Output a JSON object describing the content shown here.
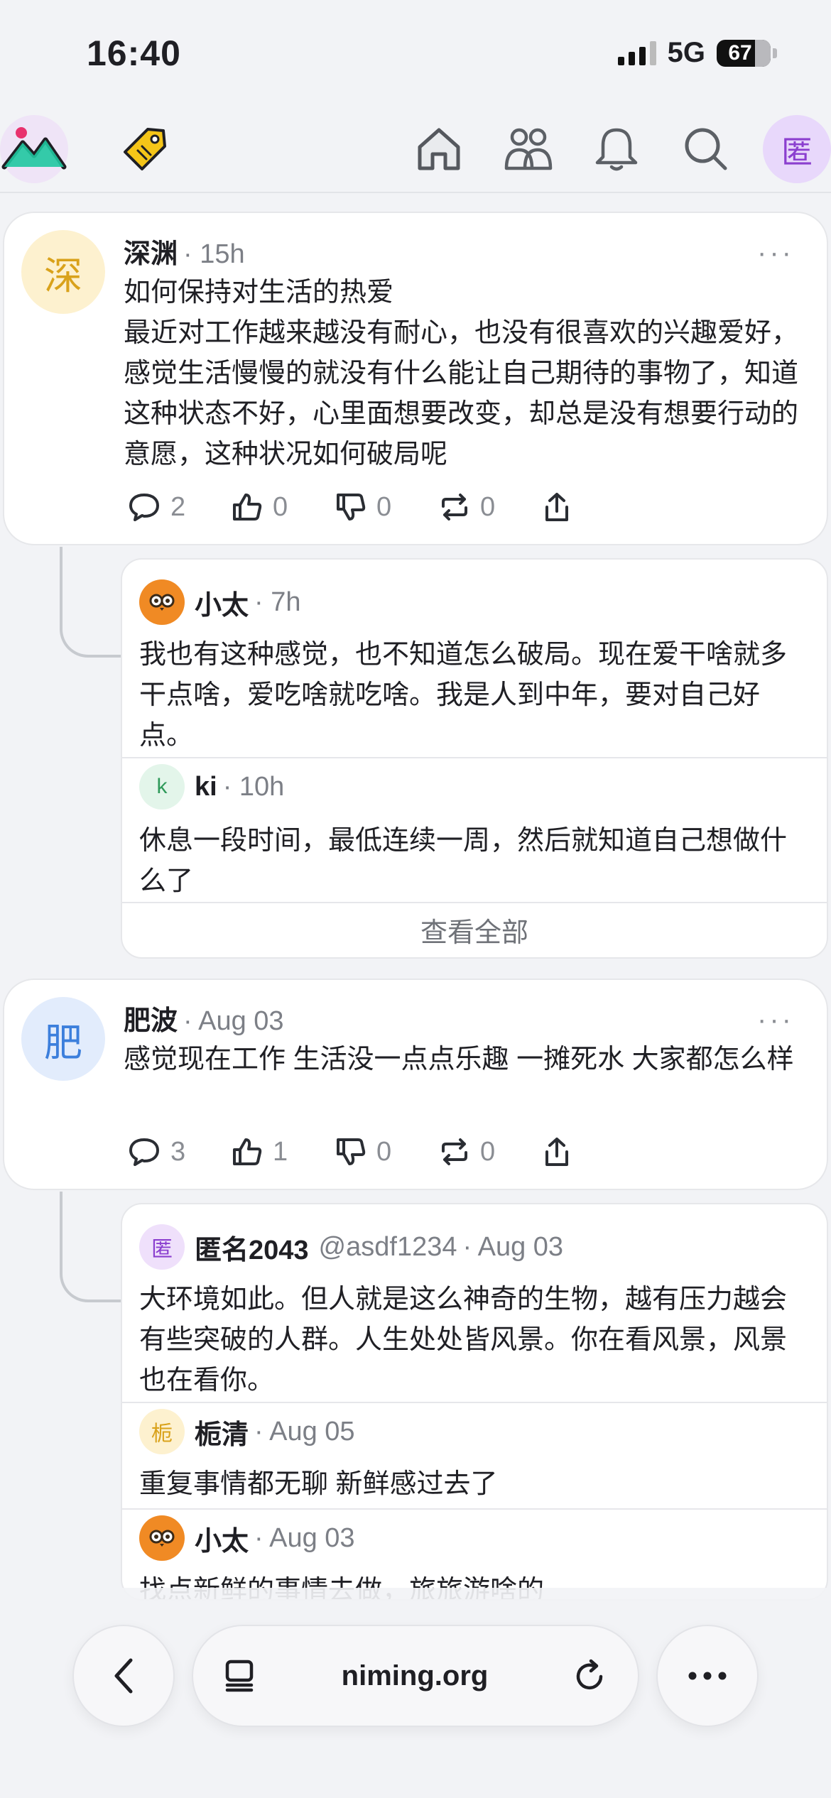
{
  "status_bar": {
    "time": "16:40",
    "network": "5G",
    "battery": "67"
  },
  "nav": {
    "avatar_label": "匿"
  },
  "posts": [
    {
      "avatar_text": "深",
      "author": "深渊",
      "time": "· 15h",
      "text": "如何保持对生活的热爱\n最近对工作越来越没有耐心，也没有很喜欢的兴趣爱好，感觉生活慢慢的就没有什么能让自己期待的事物了，知道这种状态不好，心里面想要改变，却总是没有想要行动的意愿，这种状况如何破局呢",
      "comments": "2",
      "likes": "0",
      "dislikes": "0",
      "reposts": "0",
      "replies": [
        {
          "avatar_text": "",
          "author": "小太",
          "time": "· 7h",
          "text": "我也有这种感觉，也不知道怎么破局。现在爱干啥就多干点啥，爱吃啥就吃啥。我是人到中年，要对自己好点。"
        },
        {
          "avatar_text": "k",
          "author": "ki",
          "time": "· 10h",
          "text": "休息一段时间，最低连续一周，然后就知道自己想做什么了"
        }
      ],
      "view_all": "查看全部"
    },
    {
      "avatar_text": "肥",
      "author": "肥波",
      "time": "· Aug 03",
      "text": "感觉现在工作 生活没一点点乐趣 一摊死水 大家都怎么样",
      "comments": "3",
      "likes": "1",
      "dislikes": "0",
      "reposts": "0",
      "replies": [
        {
          "avatar_text": "匿",
          "author": "匿名2043",
          "handle": "@asdf1234",
          "time": "· Aug 03",
          "text": "大环境如此。但人就是这么神奇的生物，越有压力越会有些突破的人群。人生处处皆风景。你在看风景，风景也在看你。"
        },
        {
          "avatar_text": "栀",
          "author": "栀清",
          "time": "· Aug 05",
          "text": "重复事情都无聊 新鲜感过去了"
        },
        {
          "avatar_text": "",
          "author": "小太",
          "time": "· Aug 03",
          "text": "找点新鲜的事情去做，旅旅游啥的"
        }
      ]
    }
  ],
  "browser": {
    "url": "niming.org"
  },
  "colors": {
    "accent": "#8b3fcf",
    "background": "#f2f3f6",
    "muted": "#7c7f86"
  }
}
